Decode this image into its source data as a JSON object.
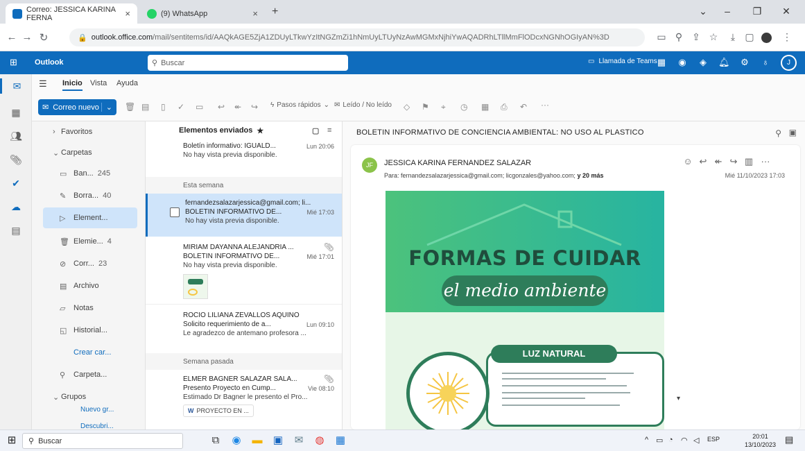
{
  "browser": {
    "tabs": [
      {
        "title": "Correo: JESSICA KARINA FERNA",
        "favicon_color": "#0f6cbd",
        "close": "×"
      },
      {
        "title": "(9) WhatsApp",
        "favicon_color": "#25d366",
        "close": "×"
      }
    ],
    "new_tab": "+",
    "window_controls": [
      "⌄",
      "–",
      "❐",
      "✕"
    ],
    "url_domain": "outlook.office.com",
    "url_path": "/mail/sentitems/id/AAQkAGE5ZjA1ZDUyLTkwYzItNGZmZi1hNmUyLTUyNzAwMGMxNjhiYwAQADRhLTllMmFlODcxNGNhOGIyAN%3D"
  },
  "outlook": {
    "app_name": "Outlook",
    "search_placeholder": "Buscar",
    "teams_call": "Llamada de Teams"
  },
  "ribbon": {
    "tabs": [
      "Inicio",
      "Vista",
      "Ayuda"
    ],
    "new_mail": "Correo nuevo",
    "quick_steps": "Pasos rápidos",
    "read_unread": "Leído / No leído",
    "more": "···"
  },
  "folders": {
    "favorites": "Favoritos",
    "folders_label": "Carpetas",
    "items": [
      {
        "name": "Ban...",
        "count": "245",
        "icon": "inbox-icon"
      },
      {
        "name": "Borra...",
        "count": "40",
        "icon": "drafts-icon"
      },
      {
        "name": "Element...",
        "count": "",
        "icon": "sent-icon"
      },
      {
        "name": "Elemie...",
        "count": "4",
        "icon": "trash-icon"
      },
      {
        "name": "Corr...",
        "count": "23",
        "icon": "junk-icon"
      },
      {
        "name": "Archivo",
        "count": "",
        "icon": "archive-icon"
      },
      {
        "name": "Notas",
        "count": "",
        "icon": "notes-icon"
      },
      {
        "name": "Historial...",
        "count": "",
        "icon": "history-icon"
      }
    ],
    "create_folder": "Crear car...",
    "search_folders": "Carpeta...",
    "groups": "Grupos",
    "new_group": "Nuevo gr...",
    "discover": "Descubri..."
  },
  "message_list": {
    "title": "Elementos enviados",
    "top_partial": {
      "subject": "Boletín informativo: IGUALD...",
      "time": "Lun 20:06",
      "preview": "No hay vista previa disponible."
    },
    "section_this_week": "Esta semana",
    "section_last_week": "Semana pasada",
    "messages": [
      {
        "from": "fernandezsalazarjessica@gmail.com; li...",
        "subject": "BOLETIN INFORMATIVO DE...",
        "time": "Mié 17:03",
        "preview": "No hay vista previa disponible."
      },
      {
        "from": "MIRIAM DAYANNA ALEJANDRIA ...",
        "subject": "BOLETIN INFORMATIVO DE...",
        "time": "Mié 17:01",
        "preview": "No hay vista previa disponible."
      },
      {
        "from": "ROCIO LILIANA ZEVALLOS AQUINO",
        "subject": "Solicito requerimiento de a...",
        "time": "Lun 09:10",
        "preview": "Le agradezco de antemano profesora ..."
      },
      {
        "from": "ELMER BAGNER SALAZAR SALA...",
        "subject": "Presento Proyecto en Cump...",
        "time": "Vie 08:10",
        "preview": "Estimado Dr Bagner le presento el Pro...",
        "attachment": "PROYECTO EN ..."
      }
    ]
  },
  "reading": {
    "subject": "BOLETIN INFORMATIVO DE CONCIENCIA AMBIENTAL: NO USO AL PLASTICO",
    "avatar": "JF",
    "sender": "JESSICA KARINA FERNANDEZ SALAZAR",
    "to_label": "Para:",
    "to": "fernandezsalazarjessica@gmail.com;  licgonzales@yahoo.com;",
    "more_recipients": "y 20 más",
    "date": "Mié 11/10/2023 17:03",
    "flyer": {
      "headline": "FORMAS DE CUIDAR",
      "subline": "el medio ambiente",
      "section": "LUZ NATURAL"
    }
  },
  "taskbar": {
    "search": "Buscar",
    "time": "20:01",
    "date": "13/10/2023",
    "lang": "ESP"
  },
  "colors": {
    "outlook_blue": "#0f6cbd",
    "selected_bg": "#cfe4fa",
    "flyer_green": "#2e7d5a"
  }
}
